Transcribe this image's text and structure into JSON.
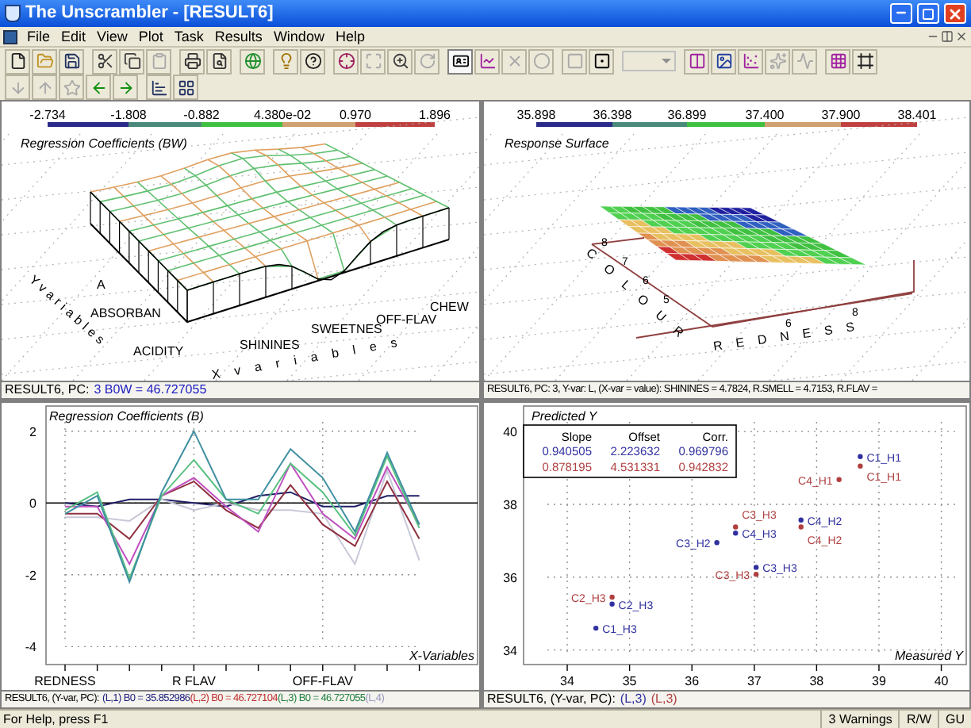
{
  "window": {
    "title": "The Unscrambler - [RESULT6]"
  },
  "menu": [
    {
      "label": "File"
    },
    {
      "label": "Edit"
    },
    {
      "label": "View"
    },
    {
      "label": "Plot"
    },
    {
      "label": "Task"
    },
    {
      "label": "Results"
    },
    {
      "label": "Window"
    },
    {
      "label": "Help"
    }
  ],
  "toolbar_1": [
    [
      {
        "disabled": false,
        "pressed": false
      },
      {
        "disabled": false,
        "pressed": false
      },
      {
        "disabled": false,
        "pressed": false
      }
    ],
    [
      {
        "disabled": false,
        "pressed": false
      },
      {
        "disabled": false,
        "pressed": false
      },
      {
        "disabled": true,
        "pressed": false
      }
    ],
    [
      {
        "disabled": false,
        "pressed": false
      },
      {
        "disabled": false,
        "pressed": false
      }
    ],
    [
      {
        "disabled": false,
        "pressed": false
      }
    ],
    [
      {
        "disabled": false,
        "pressed": false
      },
      {
        "disabled": false,
        "pressed": false
      }
    ],
    [
      {
        "disabled": false,
        "pressed": false
      },
      {
        "disabled": true,
        "pressed": false
      },
      {
        "disabled": false,
        "pressed": false
      },
      {
        "disabled": true,
        "pressed": false
      }
    ],
    [
      {
        "disabled": false,
        "pressed": true
      },
      {
        "disabled": false,
        "pressed": false
      },
      {
        "disabled": true,
        "pressed": false
      },
      {
        "disabled": true,
        "pressed": false
      }
    ],
    [
      {
        "disabled": true,
        "pressed": false
      },
      {
        "disabled": false,
        "pressed": false
      }
    ],
    [
      {
        "disabled": false,
        "pressed": false
      },
      {
        "disabled": false,
        "pressed": false
      },
      {
        "disabled": false,
        "pressed": false
      },
      {
        "disabled": true,
        "pressed": false
      },
      {
        "disabled": true,
        "pressed": false
      }
    ],
    [
      {
        "disabled": false,
        "pressed": false
      },
      {
        "disabled": false,
        "pressed": false
      }
    ]
  ],
  "combo": {
    "disabled": true
  },
  "toolbar_2": [
    [
      {
        "disabled": true
      },
      {
        "disabled": true
      },
      {
        "disabled": true
      },
      {
        "disabled": false
      },
      {
        "disabled": false
      }
    ],
    [
      {
        "disabled": false
      },
      {
        "disabled": false
      }
    ]
  ],
  "coefficients_3d": {
    "title": "Regression Coefficients (BW)",
    "color_scale": [
      "-2.734",
      "-1.808",
      "-0.882",
      "4.380e-02",
      "0.970",
      "1.896"
    ],
    "y_axis_title": "Yvariables",
    "x_axis_title": "Xvariables",
    "y_labels": [
      "A",
      "ABSORBAN",
      "ACIDITY"
    ],
    "x_labels": [
      "SHININES",
      "SWEETNES",
      "OFF-FLAV",
      "CHEW"
    ],
    "status": {
      "prefix": "RESULT6, PC:",
      "value": "3 B0W = 46.727055"
    }
  },
  "response_surface": {
    "title": "Response Surface",
    "color_scale": [
      "35.898",
      "36.398",
      "36.899",
      "37.400",
      "37.900",
      "38.401"
    ],
    "y_axis_title": "COLOUR",
    "y_ticks": [
      "8",
      "7",
      "6",
      "5"
    ],
    "x_axis_title": "REDNESS",
    "x_ticks": [
      "6",
      "8"
    ],
    "status": "RESULT6, PC: 3, Y-var: L, (X-var = value): SHININES = 4.7824, R.SMELL = 4.7153, R.FLAV ="
  },
  "coefficients_plot": {
    "chart_data": {
      "type": "line",
      "title": "Regression Coefficients (B)",
      "xlabel": "X-Variables",
      "categories": [
        "REDNESS",
        null,
        null,
        null,
        "R FLAV",
        null,
        null,
        null,
        "OFF-FLAV",
        null,
        null,
        null
      ],
      "yticks": [
        -4,
        -2,
        0,
        2
      ],
      "ylim": [
        -4.5,
        2.7
      ],
      "grid": true,
      "series": [
        {
          "color": "#202068",
          "values": [
            0,
            -0.1,
            0.1,
            0.1,
            0,
            -0.1,
            0.2,
            0.3,
            -0.1,
            -0.1,
            0.2,
            0.2
          ]
        },
        {
          "color": "#c8c8d8",
          "values": [
            -0.4,
            -0.4,
            -0.5,
            0.1,
            -0.2,
            0,
            -0.2,
            -0.2,
            -0.3,
            -1.7,
            0.9,
            -1.6
          ]
        },
        {
          "color": "#903040",
          "values": [
            -0.3,
            -0.3,
            -1.0,
            0.2,
            0.6,
            -0.2,
            -0.7,
            0.5,
            -0.6,
            -1.2,
            0.6,
            -1.0
          ]
        },
        {
          "color": "#c050c0",
          "values": [
            -0.1,
            -0.1,
            -1.7,
            0.2,
            0.7,
            -0.1,
            -0.8,
            1.1,
            -0.3,
            -1.0,
            1.0,
            -0.6
          ]
        },
        {
          "color": "#58c080",
          "values": [
            -0.2,
            0.3,
            -2.1,
            0.2,
            1.2,
            0.1,
            -0.3,
            1.1,
            0.3,
            -0.9,
            1.3,
            -0.7
          ]
        },
        {
          "color": "#3f8fa0",
          "values": [
            -0.3,
            0.2,
            -2.2,
            0.3,
            2.0,
            0.1,
            0.1,
            1.5,
            0.7,
            -0.8,
            1.4,
            -0.6
          ]
        }
      ]
    },
    "status": {
      "prefix": "RESULT6, (Y-var, PC):",
      "parts": [
        {
          "text": "(L,1) B0 = 35.852986",
          "color": "#202080"
        },
        {
          "text": "(L,2) B0 = 46.727104",
          "color": "#c03030"
        },
        {
          "text": "(L,3) B0 = 46.727055",
          "color": "#208040"
        },
        {
          "text": "(L,4)",
          "color": "#9898c0"
        }
      ]
    }
  },
  "predicted_plot": {
    "chart_data": {
      "type": "scatter",
      "xlabel": "Measured Y",
      "ylabel": "Predicted Y",
      "xticks": [
        34,
        35,
        36,
        37,
        38,
        39,
        40
      ],
      "yticks": [
        34,
        36,
        38,
        40
      ],
      "xlim": [
        33.3,
        40.4
      ],
      "ylim": [
        33.6,
        40.7
      ],
      "grid": true,
      "series": [
        {
          "color": "#3030a0",
          "x": [
            34.46,
            34.72,
            36.4,
            36.7,
            37.03,
            37.75,
            38.7
          ],
          "values": [
            34.6,
            35.26,
            36.95,
            37.21,
            36.27,
            37.57,
            39.31
          ]
        },
        {
          "color": "#b04040",
          "x": [
            34.72,
            36.7,
            37.03,
            37.75,
            38.36,
            38.7
          ],
          "values": [
            35.45,
            37.38,
            36.08,
            37.38,
            38.68,
            39.05
          ]
        }
      ],
      "annotations": [
        {
          "x": 34.46,
          "y": 34.6,
          "text": "C1_H3"
        },
        {
          "x": 34.72,
          "y": 35.26,
          "text": "C2_H3"
        },
        {
          "x": 36.4,
          "y": 36.95,
          "text": "C3_H2"
        },
        {
          "x": 36.7,
          "y": 37.21,
          "text": "C4_H3"
        },
        {
          "x": 37.03,
          "y": 36.27,
          "text": "C3_H3"
        },
        {
          "x": 37.75,
          "y": 37.57,
          "text": "C4_H2"
        },
        {
          "x": 38.7,
          "y": 39.31,
          "text": "C1_H1"
        },
        {
          "x": 34.72,
          "y": 35.45,
          "text": "C2_H3"
        },
        {
          "x": 36.7,
          "y": 37.38,
          "text": "C3_H3"
        },
        {
          "x": 37.03,
          "y": 36.08,
          "text": "C3_H3"
        },
        {
          "x": 37.75,
          "y": 37.38,
          "text": "C4_H2"
        },
        {
          "x": 38.36,
          "y": 38.68,
          "text": "C4_H1"
        },
        {
          "x": 38.7,
          "y": 39.05,
          "text": "C1_H1"
        }
      ]
    },
    "fit_table": {
      "columns": [
        "Slope",
        "Offset",
        "Corr."
      ],
      "rows": [
        {
          "color": "#3030a0",
          "values": [
            "0.940505",
            "2.223632",
            "0.969796"
          ]
        },
        {
          "color": "#b04040",
          "values": [
            "0.878195",
            "4.531331",
            "0.942832"
          ]
        }
      ]
    },
    "status": {
      "prefix": "RESULT6, (Y-var, PC):",
      "parts": [
        {
          "text": "(L,3)",
          "color": "#3030a0"
        },
        {
          "text": "(L,3)",
          "color": "#b04040"
        }
      ]
    }
  },
  "status_bar": {
    "message": "For Help, press F1",
    "panels": [
      "3 Warnings",
      "R/W",
      "GU"
    ]
  }
}
